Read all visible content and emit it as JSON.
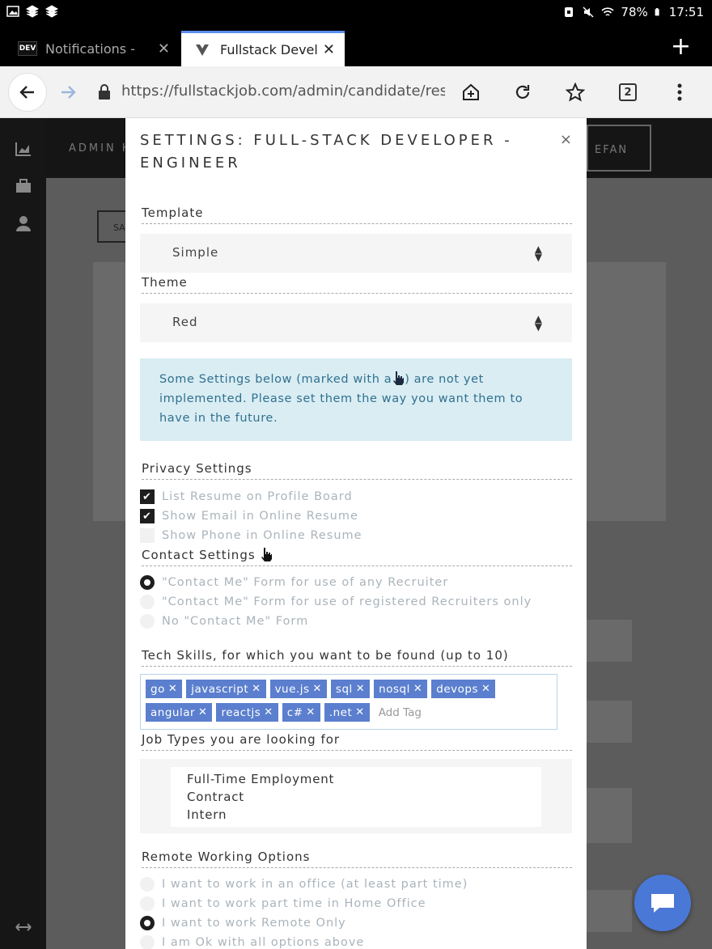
{
  "status_bar": {
    "battery": "78%",
    "time": "17:51"
  },
  "tabs": [
    {
      "label": "Notifications -",
      "favicon": "DEV"
    },
    {
      "label": "Fullstack Develop"
    }
  ],
  "address_bar": {
    "url": "https://fullstackjob.com/admin/candidate/resur",
    "tab_count": "2"
  },
  "background_page": {
    "brand": "ADMIN H",
    "user": "EFAN",
    "button": "SA"
  },
  "modal": {
    "title": "SETTINGS: FULL-STACK DEVELOPER - ENGINEER",
    "close_label": "×",
    "template": {
      "label": "Template",
      "value": "Simple"
    },
    "theme": {
      "label": "Theme",
      "value": "Red"
    },
    "info_before": "Some Settings below (marked with a",
    "info_after": ") are not yet implemented. Please set them the way you want them to have in the future.",
    "privacy": {
      "label": "Privacy Settings",
      "items": [
        {
          "label": "List Resume on Profile Board",
          "checked": true
        },
        {
          "label": "Show Email in Online Resume",
          "checked": true
        },
        {
          "label": "Show Phone in Online Resume",
          "checked": false
        }
      ]
    },
    "contact": {
      "label": "Contact Settings",
      "items": [
        {
          "label": "\"Contact Me\" Form for use of any Recruiter",
          "selected": true
        },
        {
          "label": "\"Contact Me\" Form for use of registered Recruiters only",
          "selected": false
        },
        {
          "label": "No \"Contact Me\" Form",
          "selected": false
        }
      ]
    },
    "skills": {
      "label": "Tech Skills, for which you want to be found (up to 10)",
      "tags": [
        "go",
        "javascript",
        "vue.js",
        "sql",
        "nosql",
        "devops",
        "angular",
        "reactjs",
        "c#",
        ".net"
      ],
      "add_placeholder": "Add Tag"
    },
    "job_types": {
      "label": "Job Types you are looking for",
      "options": [
        "Full-Time Employment",
        "Contract",
        "Intern"
      ]
    },
    "remote": {
      "label": "Remote Working Options",
      "items": [
        {
          "label": "I want to work in an office (at least part time)",
          "selected": false
        },
        {
          "label": "I want to work part time in Home Office",
          "selected": false
        },
        {
          "label": "I want to work Remote Only",
          "selected": true
        },
        {
          "label": "I am Ok with all options above",
          "selected": false
        }
      ]
    }
  },
  "colors": {
    "accent": "#5b7fce",
    "info_bg": "#d9edf3",
    "chat": "#4a78d6"
  }
}
